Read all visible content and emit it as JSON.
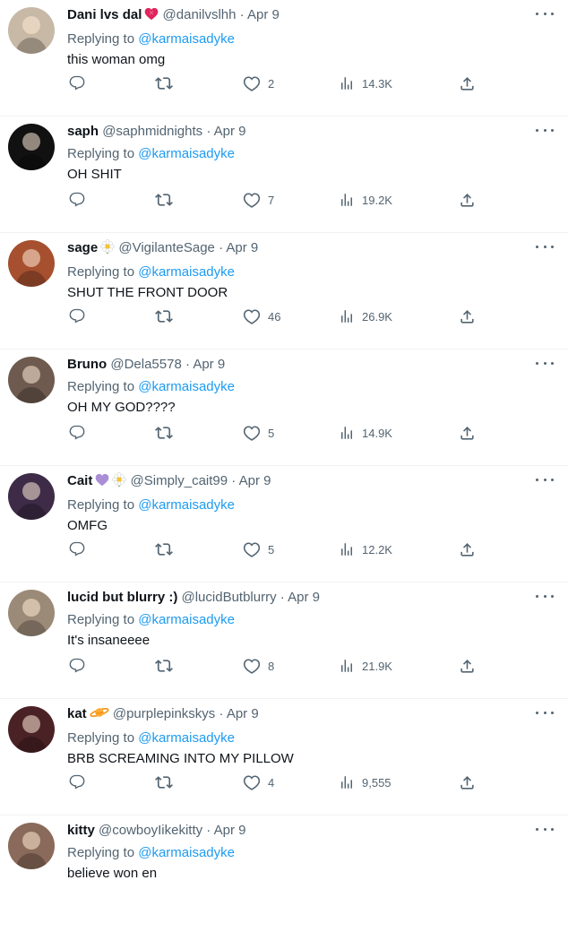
{
  "replies": [
    {
      "name": "Dani lvs dal",
      "badges": [
        "heart"
      ],
      "handle": "@danilvslhh",
      "date": "Apr 9",
      "replying_to": "@karmaisadyke",
      "text": "this woman omg",
      "likes": "2",
      "views": "14.3K",
      "avatar_color": "#c8b8a6"
    },
    {
      "name": "saph",
      "badges": [],
      "handle": "@saphmidnights",
      "date": "Apr 9",
      "replying_to": "@karmaisadyke",
      "text": "OH SHIT",
      "likes": "7",
      "views": "19.2K",
      "avatar_color": "#111111"
    },
    {
      "name": "sage",
      "badges": [
        "daisy"
      ],
      "handle": "@VigilanteSage",
      "date": "Apr 9",
      "replying_to": "@karmaisadyke",
      "text": "SHUT THE FRONT DOOR",
      "likes": "46",
      "views": "26.9K",
      "avatar_color": "#a6502f"
    },
    {
      "name": "Bruno",
      "badges": [],
      "handle": "@Dela5578",
      "date": "Apr 9",
      "replying_to": "@karmaisadyke",
      "text": "OH MY GOD????",
      "likes": "5",
      "views": "14.9K",
      "avatar_color": "#6e5a4e"
    },
    {
      "name": "Cait",
      "badges": [
        "purple-heart",
        "daisy"
      ],
      "handle": "@Simply_cait99",
      "date": "Apr 9",
      "replying_to": "@karmaisadyke",
      "text": "OMFG",
      "likes": "5",
      "views": "12.2K",
      "avatar_color": "#3d2b47"
    },
    {
      "name": "lucid but blurry :)",
      "badges": [],
      "handle": "@lucidButblurry",
      "date": "Apr 9",
      "replying_to": "@karmaisadyke",
      "text": "It's insaneeee",
      "likes": "8",
      "views": "21.9K",
      "avatar_color": "#9c8a78"
    },
    {
      "name": "kat",
      "badges": [
        "planet"
      ],
      "handle": "@purplepinkskys",
      "date": "Apr 9",
      "replying_to": "@karmaisadyke",
      "text": "BRB SCREAMING INTO MY PILLOW",
      "likes": "4",
      "views": "9,555",
      "avatar_color": "#4a2226"
    },
    {
      "name": "kitty",
      "badges": [],
      "handle": "@cowboyIikekitty",
      "date": "Apr 9",
      "replying_to": "@karmaisadyke",
      "text": "believe won en",
      "likes": "",
      "views": "",
      "avatar_color": "#8a6a5a"
    }
  ],
  "separator": "·",
  "replying_label": "Replying to"
}
